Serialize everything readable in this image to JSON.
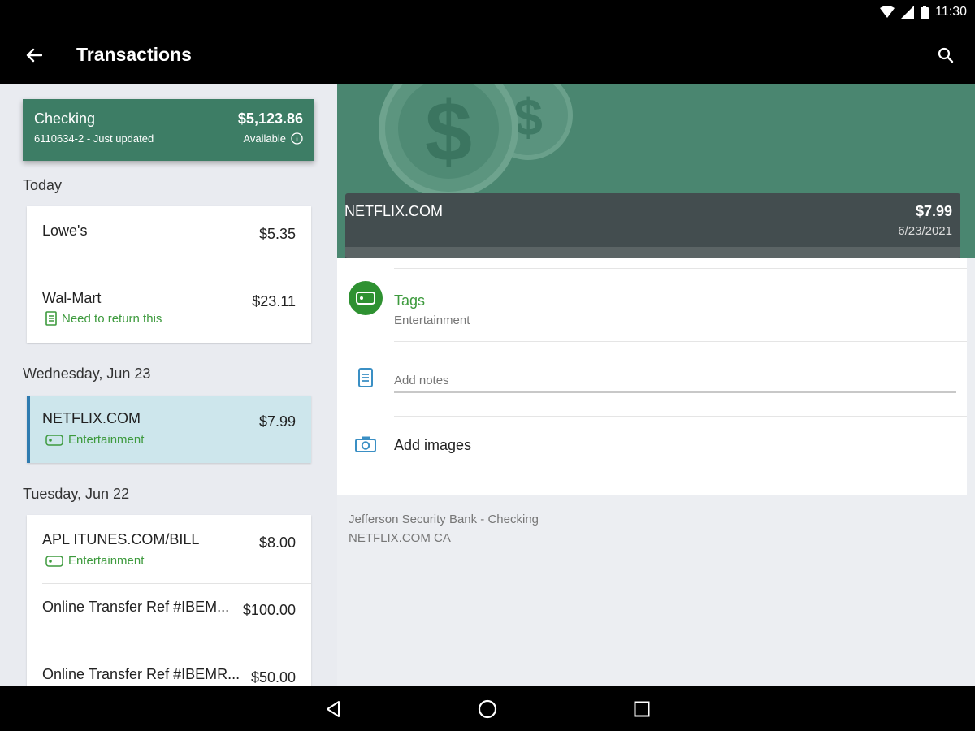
{
  "status_bar": {
    "time": "11:30"
  },
  "app_bar": {
    "title": "Transactions"
  },
  "account": {
    "name": "Checking",
    "sub": "6110634-2 - Just updated",
    "balance": "$5,123.86",
    "available_label": "Available"
  },
  "sections": [
    {
      "header": "Today",
      "transactions": [
        {
          "name": "Lowe's",
          "amount": "$5.35"
        },
        {
          "name": "Wal-Mart",
          "amount": "$23.11",
          "note": "Need to return this"
        }
      ]
    },
    {
      "header": "Wednesday, Jun 23",
      "transactions": [
        {
          "name": "NETFLIX.COM",
          "amount": "$7.99",
          "tag": "Entertainment"
        }
      ]
    },
    {
      "header": "Tuesday, Jun 22",
      "transactions": [
        {
          "name": "APL ITUNES.COM/BILL",
          "amount": "$8.00",
          "tag": "Entertainment"
        },
        {
          "name": "Online Transfer Ref #IBEM...",
          "amount": "$100.00"
        },
        {
          "name": "Online Transfer Ref #IBEMR...",
          "amount": "$50.00"
        }
      ]
    }
  ],
  "detail": {
    "merchant": "NETFLIX.COM",
    "amount": "$7.99",
    "date": "6/23/2021",
    "tags_title": "Tags",
    "tags_value": "Entertainment",
    "notes_placeholder": "Add notes",
    "images_label": "Add images",
    "account_line": "Jefferson Security Bank - Checking",
    "description_line": "NETFLIX.COM CA"
  },
  "colors": {
    "brand_green": "#3d7d65",
    "tag_green": "#3d9a3d",
    "selected_bg": "#cde6ec",
    "selected_accent": "#2f7bb0",
    "icon_blue": "#3a8fc4"
  },
  "icons": [
    "wifi-icon",
    "signal-icon",
    "battery-icon",
    "back-arrow-icon",
    "search-icon",
    "info-icon",
    "note-icon",
    "tag-icon",
    "camera-icon",
    "nav-back-icon",
    "nav-home-icon",
    "nav-recents-icon"
  ]
}
